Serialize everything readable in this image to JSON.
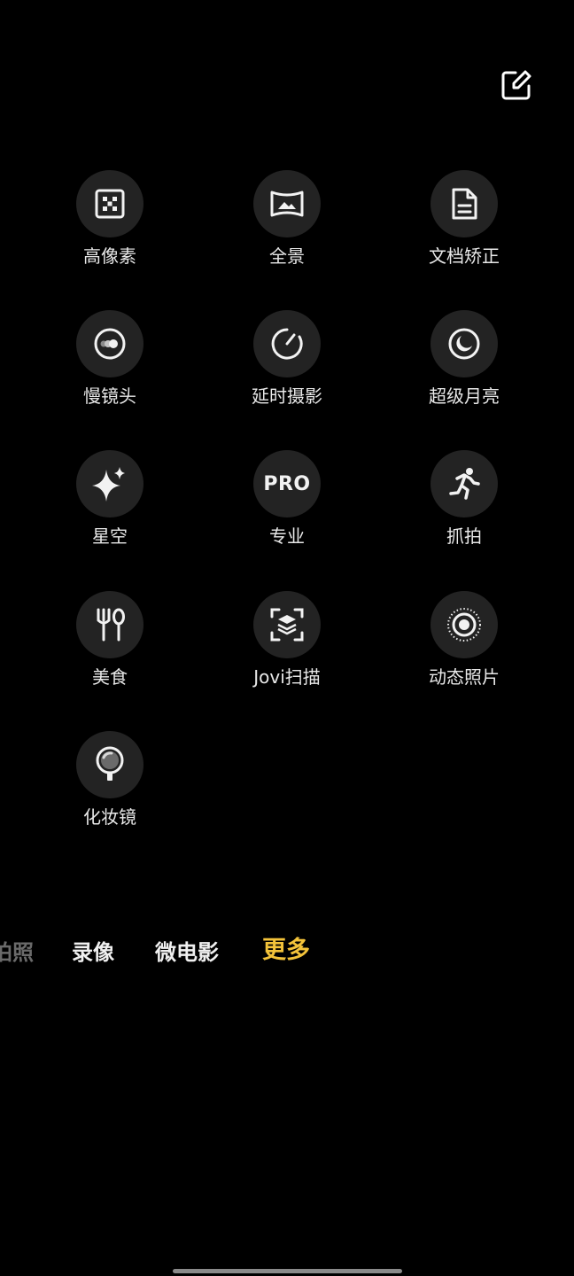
{
  "toolbar": {
    "edit_icon": "edit-square-icon"
  },
  "modes": [
    {
      "label": "高像素",
      "icon": "high-pixel-icon"
    },
    {
      "label": "全景",
      "icon": "panorama-icon"
    },
    {
      "label": "文档矫正",
      "icon": "document-icon"
    },
    {
      "label": "慢镜头",
      "icon": "slow-motion-icon"
    },
    {
      "label": "延时摄影",
      "icon": "time-lapse-icon"
    },
    {
      "label": "超级月亮",
      "icon": "moon-icon"
    },
    {
      "label": "星空",
      "icon": "sparkle-icon"
    },
    {
      "label": "专业",
      "icon": "pro-icon",
      "icon_text": "PRO"
    },
    {
      "label": "抓拍",
      "icon": "running-person-icon"
    },
    {
      "label": "美食",
      "icon": "fork-spoon-icon"
    },
    {
      "label": "Jovi扫描",
      "icon": "scan-icon"
    },
    {
      "label": "动态照片",
      "icon": "live-photo-icon"
    },
    {
      "label": "化妆镜",
      "icon": "makeup-mirror-icon"
    }
  ],
  "tabs": [
    {
      "label": "拍照",
      "state": "faded"
    },
    {
      "label": "录像",
      "state": "normal"
    },
    {
      "label": "微电影",
      "state": "normal"
    },
    {
      "label": "更多",
      "state": "active"
    }
  ],
  "colors": {
    "background": "#000000",
    "icon_circle": "#232323",
    "active_tab": "#f3c33a",
    "faded_tab": "#6a6a6a"
  }
}
